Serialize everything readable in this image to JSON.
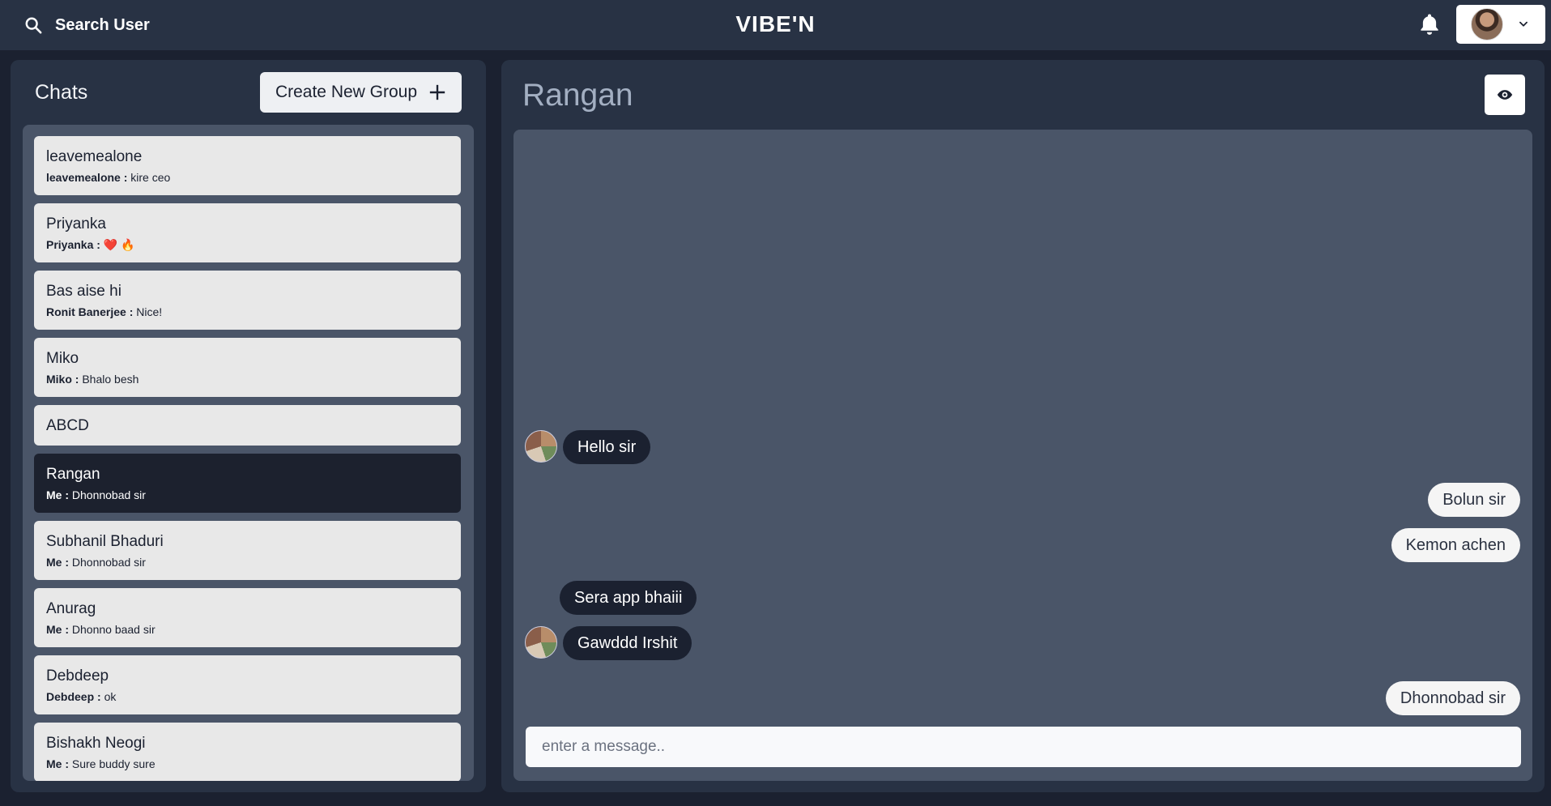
{
  "header": {
    "search_label": "Search User",
    "app_title": "VIBE'N"
  },
  "sidebar": {
    "title": "Chats",
    "create_group_label": "Create New Group",
    "chats": [
      {
        "name": "leavemealone",
        "sender": "leavemealone :",
        "message": "kire ceo",
        "active": false
      },
      {
        "name": "Priyanka",
        "sender": "Priyanka :",
        "message": "❤️ 🔥",
        "active": false
      },
      {
        "name": "Bas aise hi",
        "sender": "Ronit Banerjee :",
        "message": "Nice!",
        "active": false
      },
      {
        "name": "Miko",
        "sender": "Miko :",
        "message": "Bhalo besh",
        "active": false
      },
      {
        "name": "ABCD",
        "sender": "",
        "message": "",
        "active": false
      },
      {
        "name": "Rangan",
        "sender": "Me :",
        "message": "Dhonnobad sir",
        "active": true
      },
      {
        "name": "Subhanil Bhaduri",
        "sender": "Me :",
        "message": "Dhonnobad sir",
        "active": false
      },
      {
        "name": "Anurag",
        "sender": "Me :",
        "message": "Dhonno baad sir",
        "active": false
      },
      {
        "name": "Debdeep",
        "sender": "Debdeep :",
        "message": "ok",
        "active": false
      },
      {
        "name": "Bishakh Neogi",
        "sender": "Me :",
        "message": "Sure buddy sure",
        "active": false
      }
    ]
  },
  "conversation": {
    "title": "Rangan",
    "messages": [
      {
        "text": "Hello sir",
        "direction": "in",
        "avatar": true
      },
      {
        "text": "Bolun sir",
        "direction": "out",
        "avatar": false
      },
      {
        "text": "Kemon achen",
        "direction": "out",
        "avatar": false
      },
      {
        "text": "Sera app bhaiii",
        "direction": "in",
        "avatar": false
      },
      {
        "text": "Gawddd Irshit",
        "direction": "in",
        "avatar": true
      },
      {
        "text": "Dhonnobad sir",
        "direction": "out",
        "avatar": false
      }
    ],
    "input_placeholder": "enter a message.."
  },
  "icons": {
    "search": "search-icon",
    "bell": "bell-icon",
    "chevron": "chevron-down-icon",
    "plus": "plus-icon",
    "eye": "eye-icon"
  },
  "colors": {
    "background": "#1b2130",
    "panel": "#283244",
    "inner_panel": "#4a5568",
    "active_chat": "#1c212e",
    "chat_item": "#e8e8e8"
  }
}
